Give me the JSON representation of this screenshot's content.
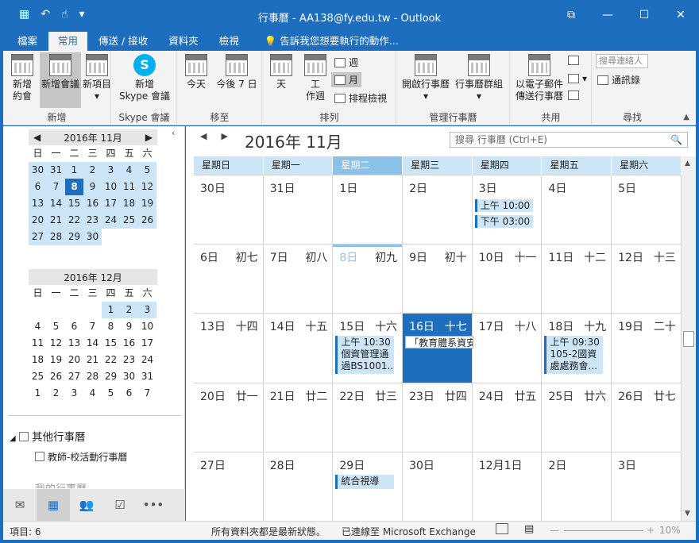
{
  "window": {
    "title": "行事曆 - AA138@fy.edu.tw - Outlook",
    "controls": [
      "⧉",
      "—",
      "☐",
      "✕"
    ]
  },
  "tabs": [
    "檔案",
    "常用",
    "傳送 / 接收",
    "資料夾",
    "檢視",
    "告訴我您想要執行的動作..."
  ],
  "ribbon": {
    "new_group_label": "新增",
    "new_appt": "新增\n約會",
    "new_meeting": "新增會議",
    "new_items": "新項目",
    "skype_group_label": "Skype 會議",
    "skype_meeting": "新增\nSkype 會議",
    "goto_group_label": "移至",
    "today": "今天",
    "next7": "今後 7 日",
    "arrange_group_label": "排列",
    "day": "天",
    "workweek": "工\n作週",
    "week": "週",
    "month": "月",
    "schedule": "排程檢視",
    "manage_group_label": "管理行事曆",
    "open_cal": "開啟行事曆",
    "cal_groups": "行事曆群組",
    "share_group_label": "共用",
    "email_cal": "以電子郵件\n傳送行事曆",
    "find_group_label": "尋找",
    "search_contacts": "搜尋連絡人",
    "address_book": "通訊錄"
  },
  "minical_nov": {
    "title": "2016年 11月",
    "weekdays": [
      "日",
      "一",
      "二",
      "三",
      "四",
      "五",
      "六"
    ],
    "days": [
      "30",
      "31",
      "1",
      "2",
      "3",
      "4",
      "5",
      "6",
      "7",
      "8",
      "9",
      "10",
      "11",
      "12",
      "13",
      "14",
      "15",
      "16",
      "17",
      "18",
      "19",
      "20",
      "21",
      "22",
      "23",
      "24",
      "25",
      "26",
      "27",
      "28",
      "29",
      "30"
    ]
  },
  "minical_dec": {
    "title": "2016年 12月",
    "weekdays": [
      "日",
      "一",
      "二",
      "三",
      "四",
      "五",
      "六"
    ],
    "days": [
      "",
      "",
      "",
      "",
      "1",
      "2",
      "3",
      "4",
      "5",
      "6",
      "7",
      "8",
      "9",
      "10",
      "11",
      "12",
      "13",
      "14",
      "15",
      "16",
      "17",
      "18",
      "19",
      "20",
      "21",
      "22",
      "23",
      "24",
      "25",
      "26",
      "27",
      "28",
      "29",
      "30",
      "31",
      "1",
      "2",
      "3",
      "4",
      "5",
      "6",
      "7"
    ]
  },
  "left": {
    "other_calendars": "其他行事曆",
    "teacher_cal": "教師-校活動行事曆",
    "my_calendars": "我的行事曆"
  },
  "main": {
    "month_title": "2016年 11月",
    "search_placeholder": "搜尋 行事曆 (Ctrl+E)",
    "weekdays": [
      "星期日",
      "星期一",
      "星期二",
      "星期三",
      "星期四",
      "星期五",
      "星期六"
    ],
    "weeks": [
      [
        {
          "d": "30日",
          "l": ""
        },
        {
          "d": "31日",
          "l": ""
        },
        {
          "d": "1日",
          "l": ""
        },
        {
          "d": "2日",
          "l": ""
        },
        {
          "d": "3日",
          "l": ""
        },
        {
          "d": "4日",
          "l": ""
        },
        {
          "d": "5日",
          "l": ""
        }
      ],
      [
        {
          "d": "6日",
          "l": "初七"
        },
        {
          "d": "7日",
          "l": "初八"
        },
        {
          "d": "8日",
          "l": "初九"
        },
        {
          "d": "9日",
          "l": "初十"
        },
        {
          "d": "10日",
          "l": "十一"
        },
        {
          "d": "11日",
          "l": "十二"
        },
        {
          "d": "12日",
          "l": "十三"
        }
      ],
      [
        {
          "d": "13日",
          "l": "十四"
        },
        {
          "d": "14日",
          "l": "十五"
        },
        {
          "d": "15日",
          "l": "十六"
        },
        {
          "d": "16日",
          "l": "十七"
        },
        {
          "d": "17日",
          "l": "十八"
        },
        {
          "d": "18日",
          "l": "十九"
        },
        {
          "d": "19日",
          "l": "二十"
        }
      ],
      [
        {
          "d": "20日",
          "l": "廿一"
        },
        {
          "d": "21日",
          "l": "廿二"
        },
        {
          "d": "22日",
          "l": "廿三"
        },
        {
          "d": "23日",
          "l": "廿四"
        },
        {
          "d": "24日",
          "l": "廿五"
        },
        {
          "d": "25日",
          "l": "廿六"
        },
        {
          "d": "26日",
          "l": "廿七"
        }
      ],
      [
        {
          "d": "27日",
          "l": ""
        },
        {
          "d": "28日",
          "l": ""
        },
        {
          "d": "29日",
          "l": ""
        },
        {
          "d": "30日",
          "l": ""
        },
        {
          "d": "12月1日",
          "l": ""
        },
        {
          "d": "2日",
          "l": ""
        },
        {
          "d": "3日",
          "l": ""
        }
      ]
    ],
    "appointments": {
      "w0_thu_1": "上午 10:00",
      "w0_thu_2": "下午 03:00",
      "w2_tue": "上午 10:30\n個資管理通\n過BS1001...",
      "w2_wed": "「教育體系資安規範稽核員訓",
      "w2_fri": "上午 09:30\n105-2國資\n處處務會...",
      "w4_tue": "統合視導"
    }
  },
  "status": {
    "items": "項目: 6",
    "uptodate": "所有資料夾都是最新狀態。",
    "connected": "已連線至 Microsoft Exchange",
    "zoom": "10%"
  }
}
